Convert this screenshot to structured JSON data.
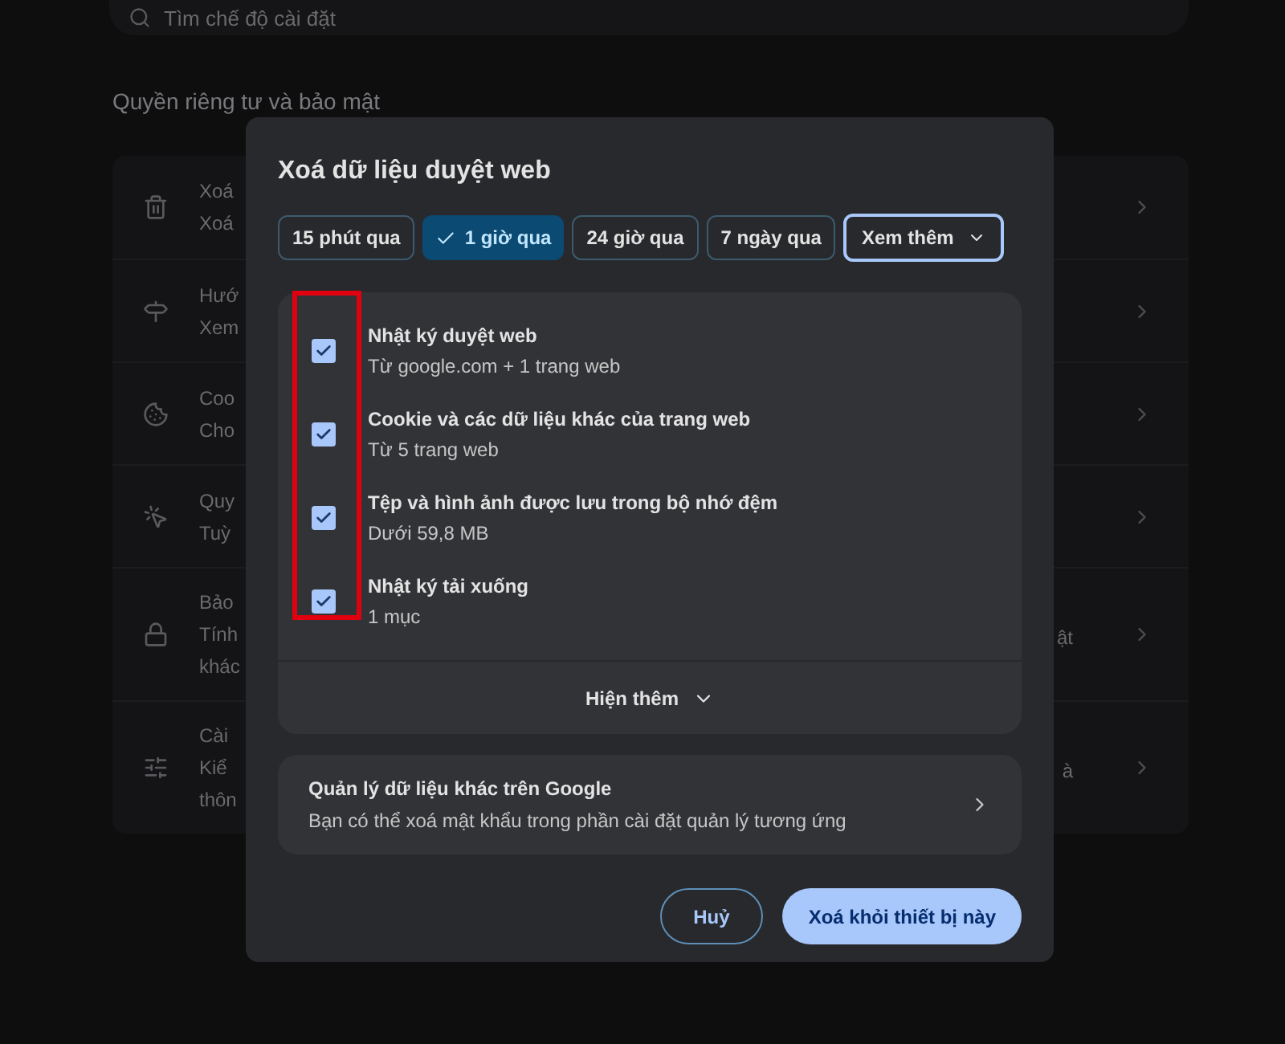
{
  "search": {
    "placeholder": "Tìm chế độ cài đặt"
  },
  "section_title": "Quyền riêng tư và bảo mật",
  "settings_rows": [
    {
      "lines": [
        "Xoá",
        "Xoá"
      ]
    },
    {
      "lines": [
        "Hướ",
        "Xem"
      ]
    },
    {
      "lines": [
        "Coo",
        "Cho"
      ]
    },
    {
      "lines": [
        "Quy",
        "Tuỳ"
      ]
    },
    {
      "lines": [
        "Bảo",
        "Tính",
        "khác"
      ],
      "trailing": "ật"
    },
    {
      "lines": [
        "Cài",
        "Kiể",
        "thôn"
      ],
      "trailing": "à"
    }
  ],
  "dialog": {
    "title": "Xoá dữ liệu duyệt web",
    "time_ranges": [
      {
        "label": "15 phút qua",
        "selected": false,
        "kind": "chip"
      },
      {
        "label": "1 giờ qua",
        "selected": true,
        "kind": "chip"
      },
      {
        "label": "24 giờ qua",
        "selected": false,
        "kind": "chip"
      },
      {
        "label": "7 ngày qua",
        "selected": false,
        "kind": "chip"
      },
      {
        "label": "Xem thêm",
        "selected": false,
        "kind": "dropdown"
      }
    ],
    "data_types": [
      {
        "label": "Nhật ký duyệt web",
        "detail": "Từ google.com + 1 trang web",
        "checked": true
      },
      {
        "label": "Cookie và các dữ liệu khác của trang web",
        "detail": "Từ 5 trang web",
        "checked": true
      },
      {
        "label": "Tệp và hình ảnh được lưu trong bộ nhớ đệm",
        "detail": "Dưới 59,8 MB",
        "checked": true
      },
      {
        "label": "Nhật ký tải xuống",
        "detail": "1 mục",
        "checked": true
      }
    ],
    "show_more": "Hiện thêm",
    "google_link": {
      "title": "Quản lý dữ liệu khác trên Google",
      "description": "Bạn có thể xoá mật khẩu trong phần cài đặt quản lý tương ứng"
    },
    "buttons": [
      {
        "label": "Huỷ",
        "kind": "secondary"
      },
      {
        "label": "Xoá khỏi thiết bị này",
        "kind": "primary"
      }
    ]
  }
}
